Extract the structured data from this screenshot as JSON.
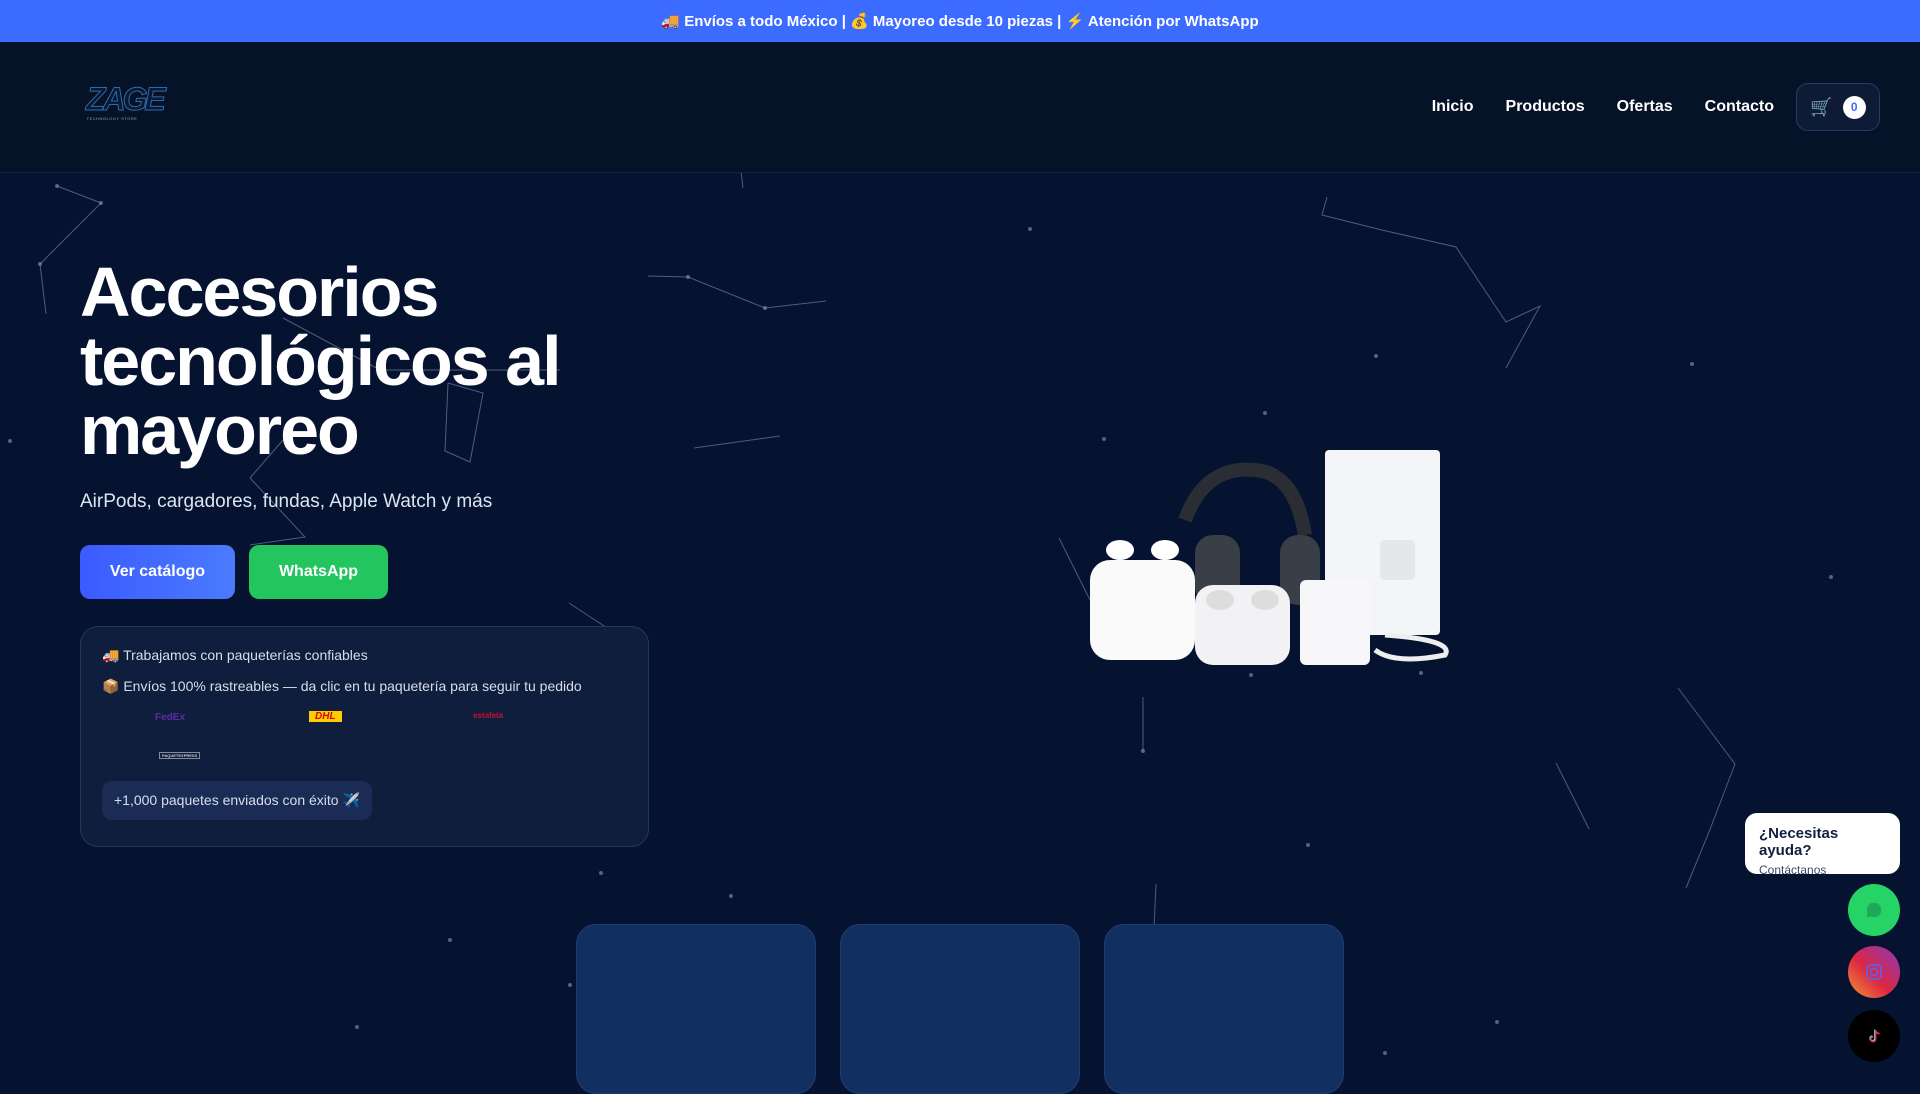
{
  "topbar": {
    "text": "🚚 Envíos a todo México | 💰 Mayoreo desde 10 piezas | ⚡ Atención por WhatsApp"
  },
  "logo": {
    "text": "ZAGE",
    "tagline": "TECHNOLOGY STORE"
  },
  "nav": [
    {
      "label": "Inicio"
    },
    {
      "label": "Productos"
    },
    {
      "label": "Ofertas"
    },
    {
      "label": "Contacto"
    }
  ],
  "cart": {
    "icon": "🛒",
    "count": "0"
  },
  "hero": {
    "title": "Accesorios tecnológicos al mayoreo",
    "subtitle": "AirPods, cargadores, fundas, Apple Watch y más",
    "primary_button": "Ver catálogo",
    "secondary_button": "WhatsApp"
  },
  "shipping": {
    "line1": "🚚 Trabajamos con paqueterías confiables",
    "line2": "📦 Envíos 100% rastreables — da clic en tu paquetería para seguir tu pedido",
    "carriers": [
      "FedEx",
      "DHL",
      "estafeta",
      "PAQUETEXPRESS"
    ],
    "badge": "+1,000 paquetes enviados con éxito ✈️"
  },
  "help": {
    "title": "¿Necesitas ayuda?",
    "subtitle": "Contáctanos"
  },
  "colors": {
    "accent": "#3b6bff",
    "whatsapp": "#22c55e",
    "bg": "#061330"
  }
}
